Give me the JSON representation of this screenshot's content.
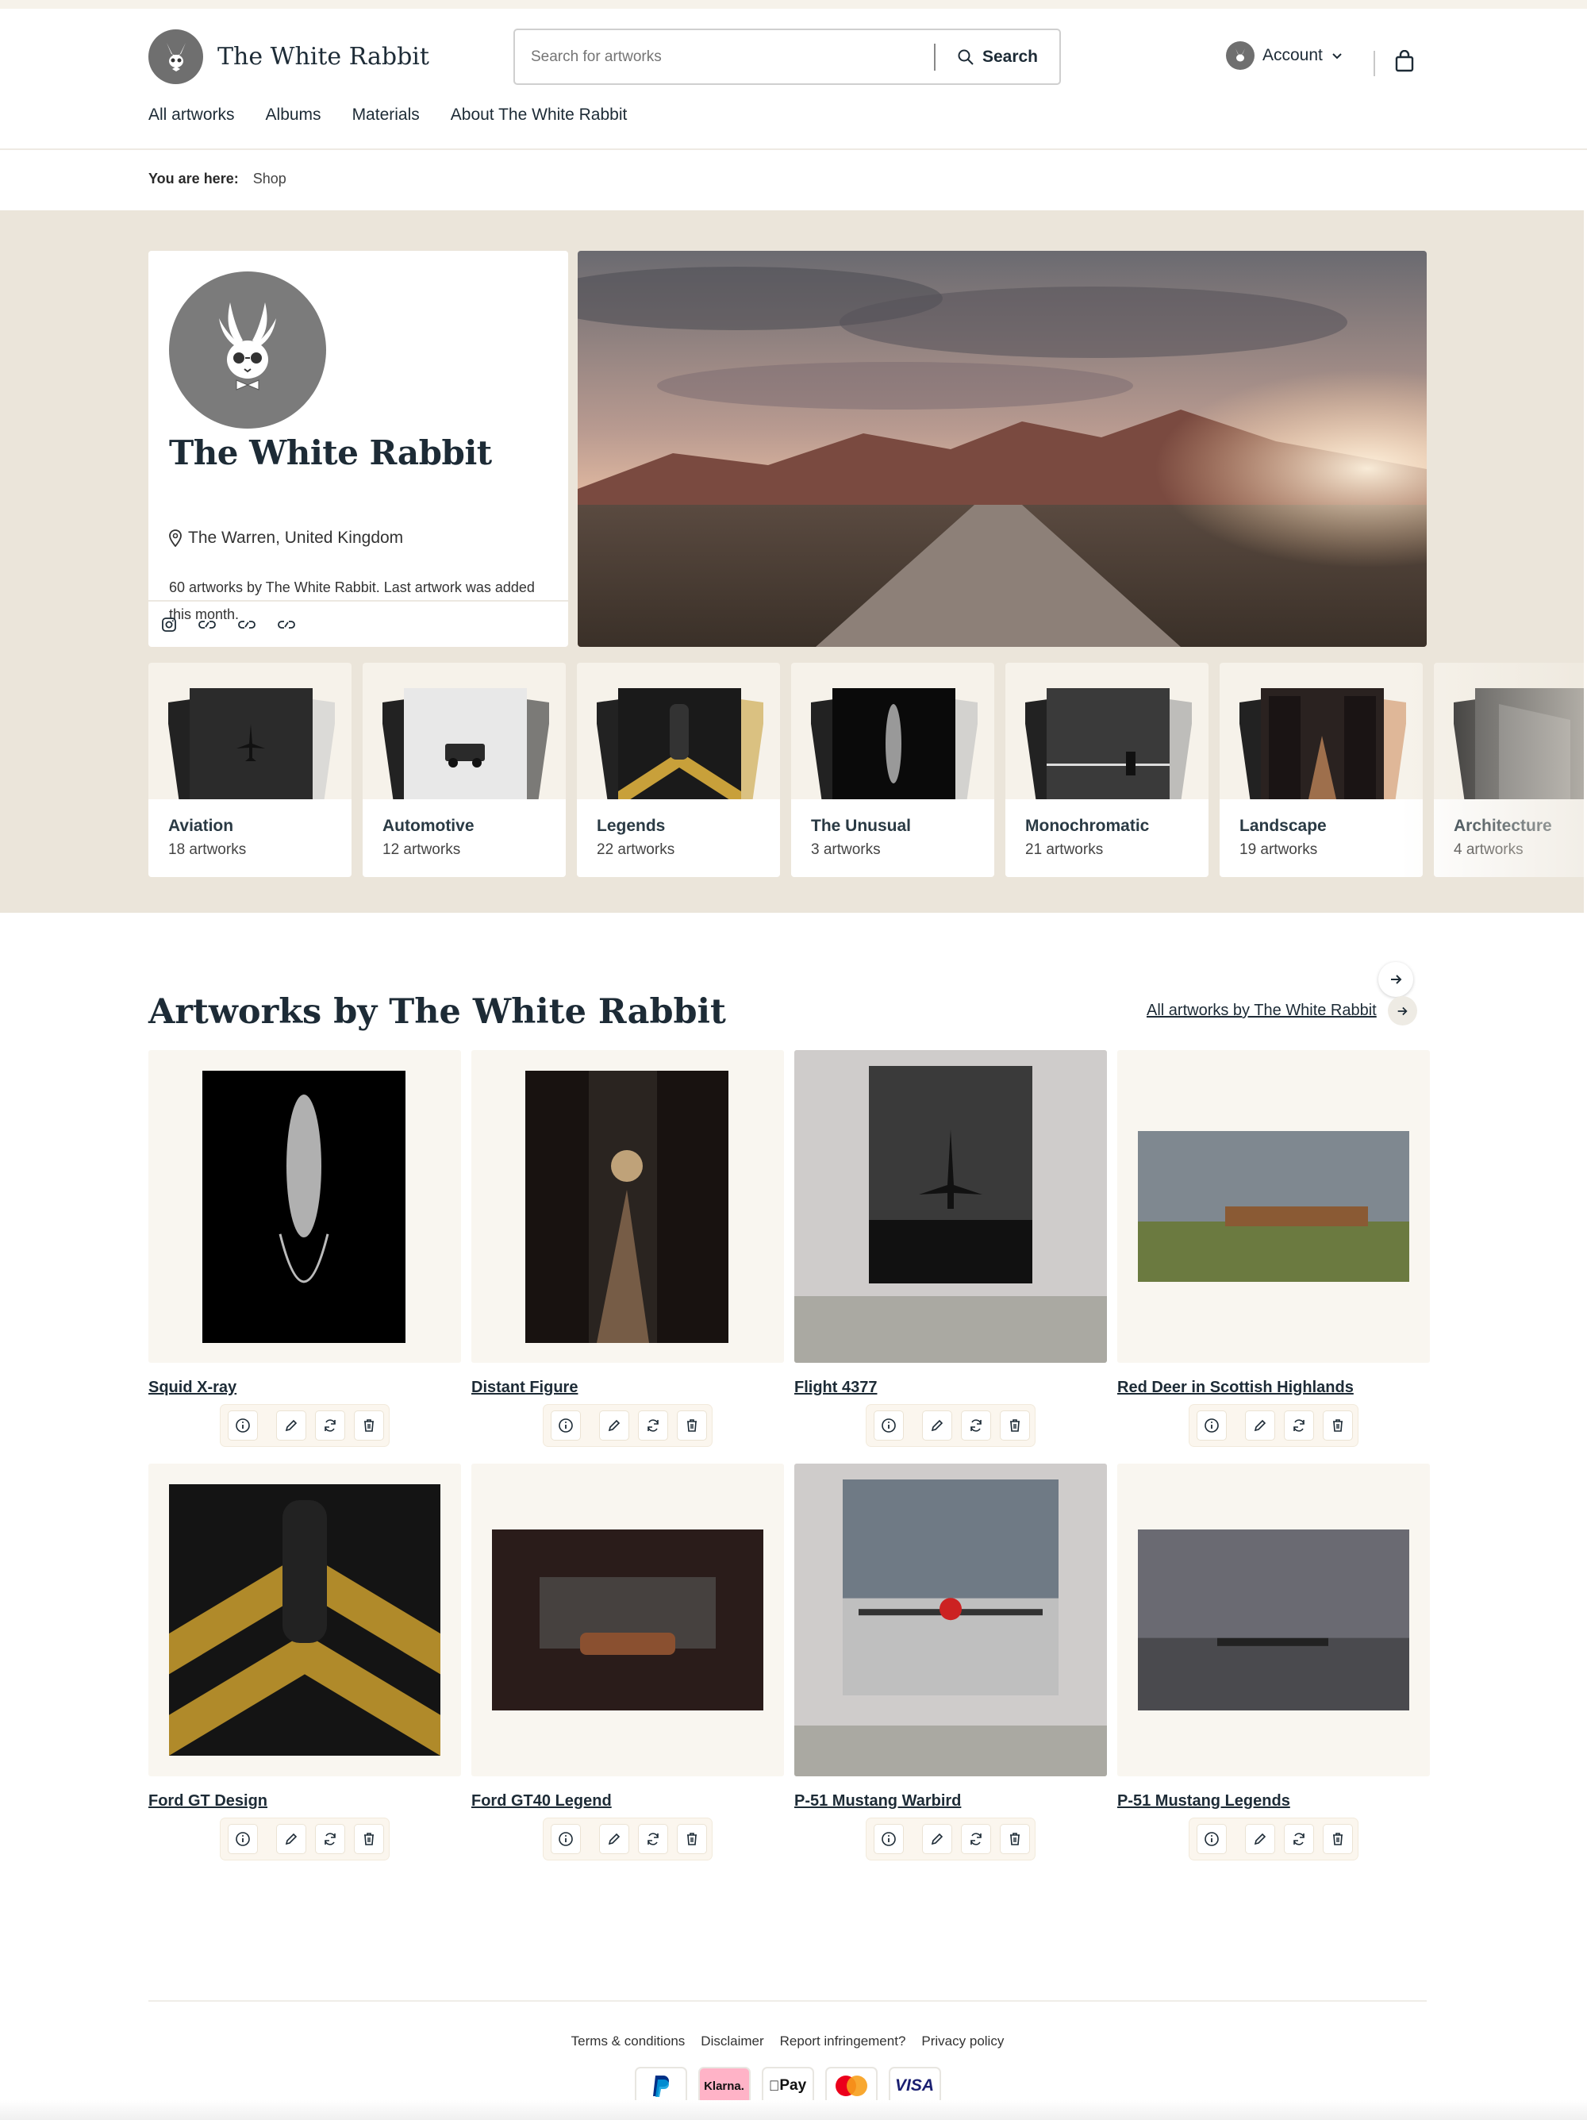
{
  "header": {
    "brand_name": "The White Rabbit",
    "search_placeholder": "Search for artworks",
    "search_button": "Search",
    "account_label": "Account"
  },
  "nav": [
    "All artworks",
    "Albums",
    "Materials",
    "About The White Rabbit"
  ],
  "breadcrumb": {
    "label": "You are here:",
    "current": "Shop"
  },
  "profile": {
    "name": "The White Rabbit",
    "location": "The Warren, United Kingdom",
    "description": "60 artworks by The White Rabbit. Last artwork was added this month."
  },
  "albums": [
    {
      "title": "Aviation",
      "count": "18 artworks"
    },
    {
      "title": "Automotive",
      "count": "12 artworks"
    },
    {
      "title": "Legends",
      "count": "22 artworks"
    },
    {
      "title": "The Unusual",
      "count": "3 artworks"
    },
    {
      "title": "Monochromatic",
      "count": "21 artworks"
    },
    {
      "title": "Landscape",
      "count": "19 artworks"
    },
    {
      "title": "Architecture",
      "count": "4 artworks"
    }
  ],
  "artworks_section": {
    "title": "Artworks by The White Rabbit",
    "all_link": "All artworks by The White Rabbit"
  },
  "artworks": [
    {
      "title": "Squid X-ray"
    },
    {
      "title": "Distant Figure"
    },
    {
      "title": "Flight 4377"
    },
    {
      "title": "Red Deer in Scottish Highlands"
    },
    {
      "title": "Ford GT Design"
    },
    {
      "title": "Ford GT40 Legend"
    },
    {
      "title": "P-51 Mustang Warbird"
    },
    {
      "title": "P-51 Mustang Legends"
    }
  ],
  "footer": {
    "links": [
      "Terms & conditions",
      "Disclaimer",
      "Report infringement?",
      "Privacy policy"
    ],
    "payments": [
      "PayPal",
      "Klarna.",
      "Pay",
      "Mastercard",
      "VISA"
    ]
  },
  "colors": {
    "hero_bg": "#ebe5da",
    "text": "#1d2b36",
    "card_bg": "#f9f6f0"
  }
}
